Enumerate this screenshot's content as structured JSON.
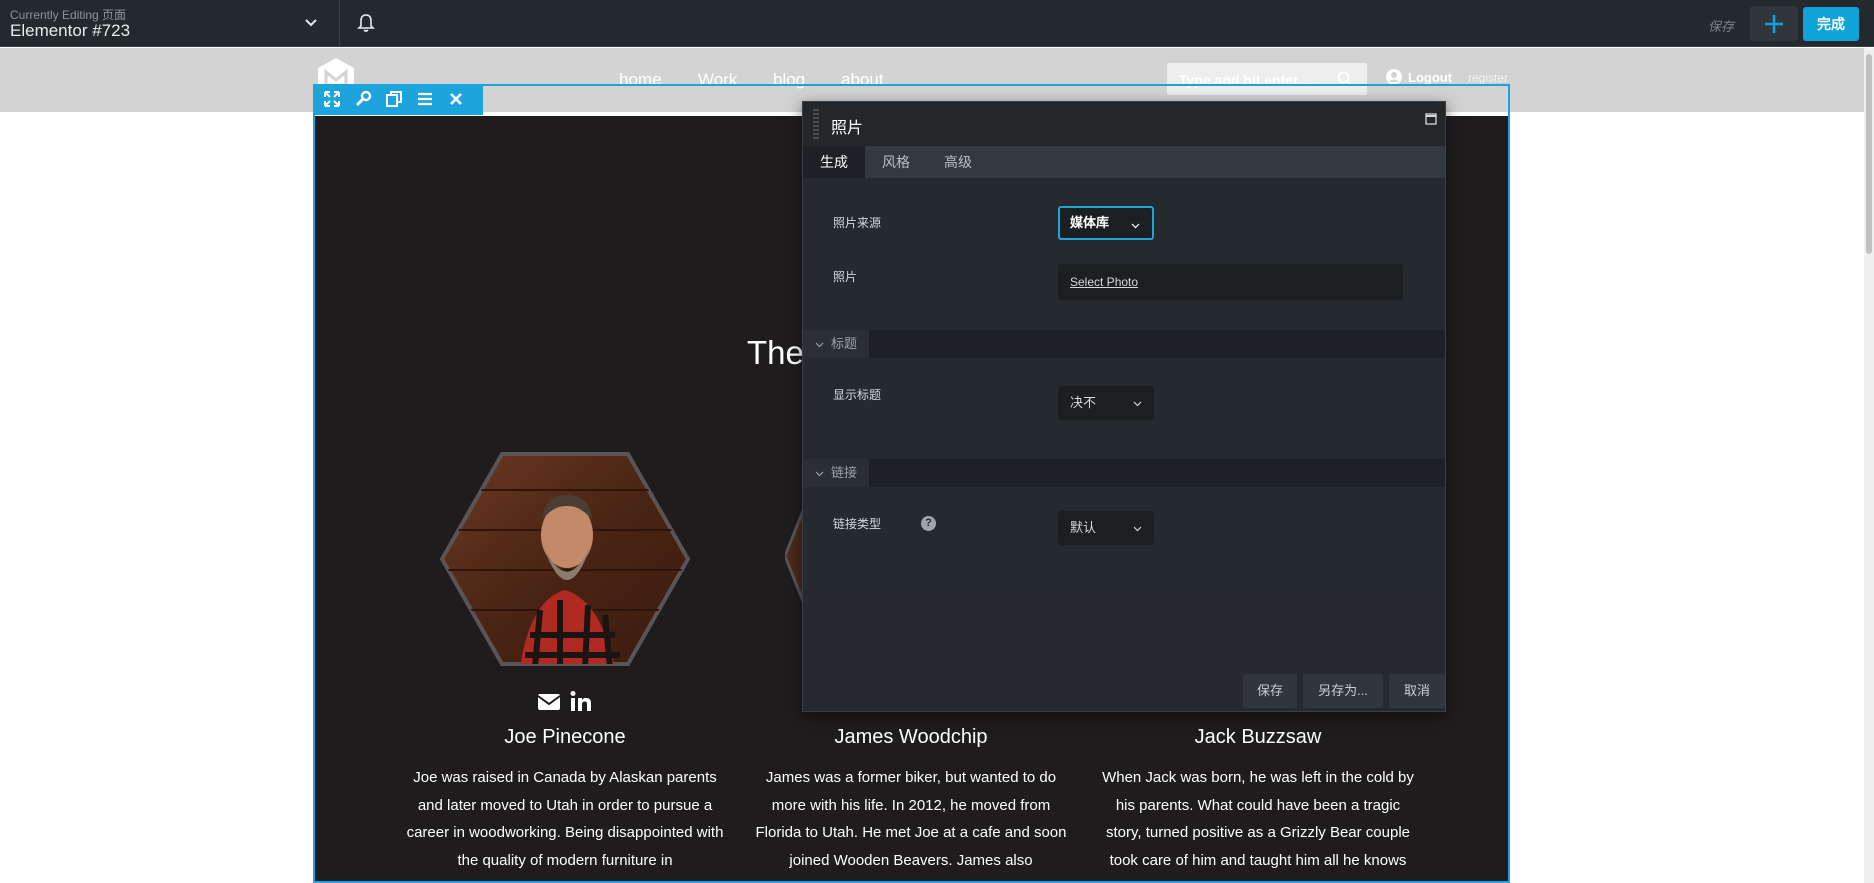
{
  "topbar": {
    "currently_editing_label": "Currently Editing 页面",
    "document_name": "Elementor #723",
    "save_link": "保存",
    "done_button": "完成"
  },
  "site": {
    "nav": [
      "home",
      "Work",
      "blog",
      "about"
    ],
    "search_placeholder": "Type and hit enter ...",
    "logout": "Logout",
    "register": "register"
  },
  "section": {
    "heading_fragment": "The"
  },
  "team": [
    {
      "name": "Joe Pinecone",
      "bio": "Joe was raised in Canada by Alaskan parents and later moved to Utah in order to pursue a career in woodworking. Being disappointed with the quality of modern furniture in"
    },
    {
      "name": "James Woodchip",
      "bio": "James was a former biker, but wanted to do more with his life. In 2012, he moved from Florida to Utah. He met Joe at a cafe and soon joined Wooden Beavers. James also"
    },
    {
      "name": "Jack Buzzsaw",
      "bio": "When Jack was born, he was left in the cold by his parents. What could have been a tragic story, turned positive as a Grizzly Bear couple took care of him and taught him all he knows"
    }
  ],
  "panel": {
    "title": "照片",
    "tabs": [
      "生成",
      "风格",
      "高级"
    ],
    "photo_source_label": "照片来源",
    "photo_source_value": "媒体库",
    "photo_label": "照片",
    "select_photo": "Select Photo",
    "caption_section": "标题",
    "show_caption_label": "显示标题",
    "show_caption_value": "决不",
    "link_section": "链接",
    "link_type_label": "链接类型",
    "link_type_value": "默认",
    "buttons": {
      "save": "保存",
      "save_as": "另存为...",
      "cancel": "取消"
    }
  },
  "colors": {
    "accent": "#1ea4dd",
    "panel_bg": "#262a2e",
    "topbar_bg": "#24292d"
  }
}
